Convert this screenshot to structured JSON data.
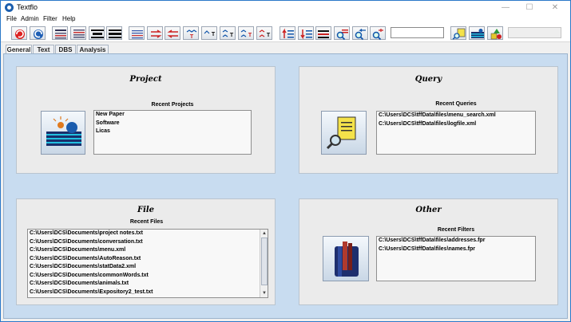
{
  "window": {
    "title": "Textflo"
  },
  "menu": [
    "File",
    "Admin",
    "Filter",
    "Help"
  ],
  "toolbar": {
    "icons": [
      "undo-icon",
      "redo-icon",
      "doc-view-icon",
      "doc-view-2-icon",
      "align-lines-icon",
      "align-lines-2-icon",
      "merge-left-icon",
      "merge-right-icon",
      "split-icon",
      "text-marker-icon",
      "text-marker-2-icon",
      "text-marker-3-icon",
      "text-marker-4-icon",
      "text-marker-5-icon",
      "sort-up-icon",
      "sort-down-icon",
      "list-icon",
      "find-icon",
      "find-back-icon",
      "find-replace-icon",
      "query-icon",
      "open-file-icon",
      "shapes-icon"
    ],
    "search_value": "",
    "status_value": ""
  },
  "tabs": [
    "General",
    "Text",
    "DBS",
    "Analysis"
  ],
  "project": {
    "title": "Project",
    "list_label": "Recent Projects",
    "items": [
      "New Paper",
      "Software",
      "Licas"
    ]
  },
  "query": {
    "title": "Query",
    "list_label": "Recent Queries",
    "items": [
      "C:\\Users\\DCS\\tffData\\files\\menu_search.xml",
      "C:\\Users\\DCS\\tffData\\files\\logfile.xml"
    ]
  },
  "file": {
    "title": "File",
    "list_label": "Recent Files",
    "items": [
      "C:\\Users\\DCS\\Documents\\project notes.txt",
      "C:\\Users\\DCS\\Documents\\conversation.txt",
      "C:\\Users\\DCS\\Documents\\menu.xml",
      "C:\\Users\\DCS\\Documents\\AutoReason.txt",
      "C:\\Users\\DCS\\Documents\\statData2.xml",
      "C:\\Users\\DCS\\Documents\\commonWords.txt",
      "C:\\Users\\DCS\\Documents\\animals.txt",
      "C:\\Users\\DCS\\Documents\\Expository2_test.txt"
    ]
  },
  "other": {
    "title": "Other",
    "list_label": "Recent Filters",
    "items": [
      "C:\\Users\\DCS\\tffData\\files\\addresses.fpr",
      "C:\\Users\\DCS\\tffData\\files\\names.fpr"
    ]
  },
  "colors": {
    "accent": "#2b78c8",
    "content_bg": "#c8dcf0",
    "panel_bg": "#ebebeb"
  }
}
